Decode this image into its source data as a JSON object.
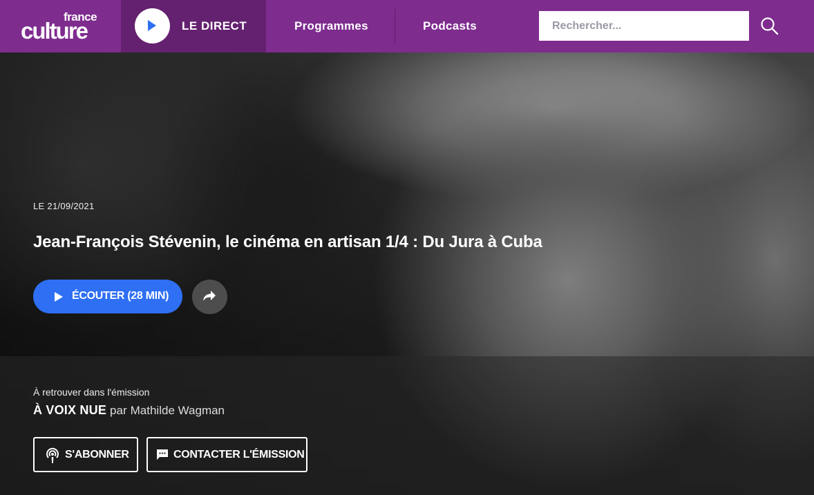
{
  "header": {
    "logo": {
      "small": "france",
      "big": "culture"
    },
    "direct_label": "LE DIRECT",
    "nav": [
      {
        "label": "Programmes"
      },
      {
        "label": "Podcasts"
      }
    ],
    "search": {
      "placeholder": "Rechercher..."
    },
    "colors": {
      "background": "#7e2c8e",
      "direct_background": "#64216f"
    }
  },
  "episode": {
    "date": "LE 21/09/2021",
    "title": "Jean-François Stévenin, le cinéma en artisan 1/4 : Du Jura à Cuba",
    "listen_label": "ÉCOUTER (28 MIN)",
    "listen_color": "#2e6ff3"
  },
  "emission": {
    "intro": "À retrouver dans l'émission",
    "name": "À VOIX NUE",
    "by": "par",
    "author": "Mathilde Wagman",
    "subscribe_label": "S'ABONNER",
    "contact_label": "CONTACTER L'ÉMISSION"
  },
  "icons": {
    "direct": "play-icon",
    "search": "search-icon",
    "listen": "play-icon",
    "share": "share-icon",
    "subscribe": "podcast-icon",
    "contact": "chat-icon"
  }
}
